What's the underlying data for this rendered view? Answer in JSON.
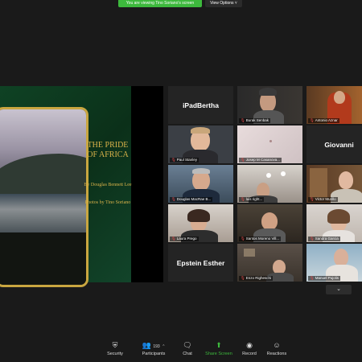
{
  "banner": {
    "viewing": "You are viewing Tino Soriano's screen",
    "view_options": "View Options ˅"
  },
  "book": {
    "title": "THE PRIDE OF AFRICA",
    "author": "By Douglas Bennett Lee",
    "photos": "Photos by Tino Soriano"
  },
  "gallery": {
    "tiles": [
      {
        "name": "iPadBertha",
        "type": "name"
      },
      {
        "label": "Burak Senbak",
        "type": "video"
      },
      {
        "label": "Antonio Aznar",
        "type": "video"
      },
      {
        "label": "Paul Stanley",
        "type": "video"
      },
      {
        "label": "Josep M Casanova...",
        "type": "video"
      },
      {
        "name": "Giovanni",
        "type": "name"
      },
      {
        "label": "Douglas MacRae B...",
        "type": "video"
      },
      {
        "label": "luis right...",
        "type": "video"
      },
      {
        "label": "Victor Murillo",
        "type": "video"
      },
      {
        "label": "Laura Prego",
        "type": "video"
      },
      {
        "label": "Santos Moreno Vill...",
        "type": "video"
      },
      {
        "label": "Sandra Garcia",
        "type": "video"
      },
      {
        "name": "Epstein Esther",
        "type": "name"
      },
      {
        "label": "Enzo Righeschi",
        "type": "video"
      },
      {
        "label": "Manuel Pujolis",
        "type": "video"
      }
    ],
    "scroll_icon": "chevron-down"
  },
  "toolbar": {
    "security": "Security",
    "participants": "Participants",
    "participants_count": "193",
    "chat": "Chat",
    "share_screen": "Share Screen",
    "record": "Record",
    "reactions": "Reactions"
  },
  "colors": {
    "accent_green": "#3db93d",
    "mic_muted": "#e24a4a",
    "book_green": "#0f3b20",
    "gold": "#d9b24a"
  }
}
